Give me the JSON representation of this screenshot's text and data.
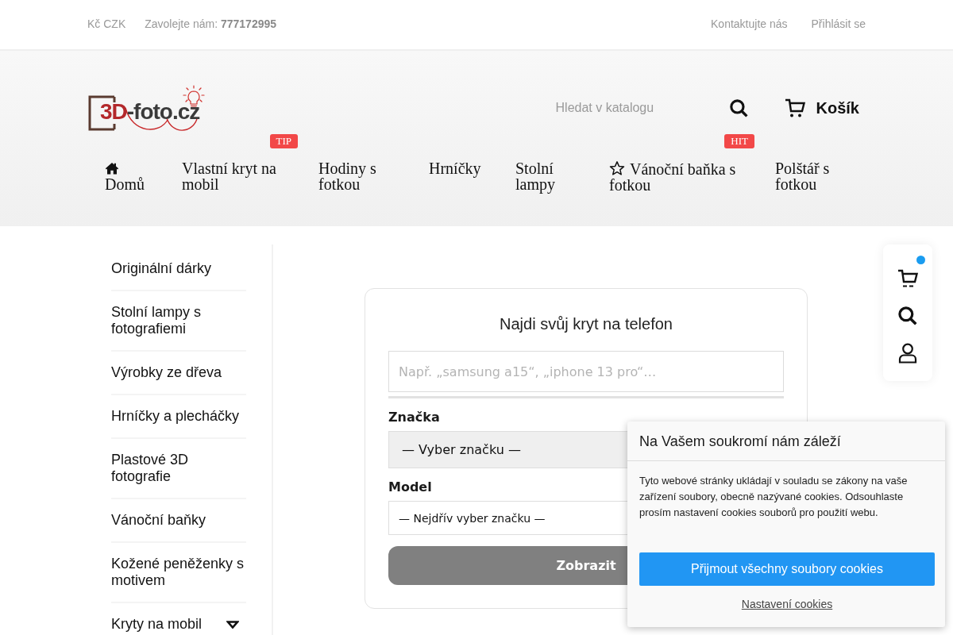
{
  "top_bar": {
    "currency": "Kč CZK",
    "phone_line": "Zavolejte nám: **777172995**",
    "links": [
      "Kontaktujte nás",
      "Přihlásit se"
    ]
  },
  "header": {
    "logo": {
      "accent": "3D",
      "text": "-foto.cz"
    },
    "search": {
      "placeholder": "Hledat v katalogu"
    },
    "cart": {
      "label": "Košík"
    }
  },
  "nav": [
    {
      "kind": "home",
      "label": "Domů"
    },
    {
      "kind": "link",
      "label": "Vlastní kryt na mobil",
      "badge": "TIP"
    },
    {
      "kind": "link",
      "label": "Hodiny s fotkou"
    },
    {
      "kind": "link",
      "label": "Hrníčky"
    },
    {
      "kind": "link",
      "label": "Stolní lampy"
    },
    {
      "kind": "featured",
      "label": "Vánoční baňka s fotkou",
      "badge": "HIT"
    },
    {
      "kind": "link",
      "label": "Polštář s fotkou"
    }
  ],
  "sidebar": {
    "items": [
      {
        "kind": "link",
        "label": "Originální dárky"
      },
      {
        "kind": "link",
        "label": "Stolní lampy s fotografiemi"
      },
      {
        "kind": "link",
        "label": "Výrobky ze dřeva"
      },
      {
        "kind": "link",
        "label": "Hrníčky a plecháčky"
      },
      {
        "kind": "link",
        "label": "Plastové 3D fotografie"
      },
      {
        "kind": "link",
        "label": "Vánoční baňky"
      },
      {
        "kind": "link",
        "label": "Kožené peněženky s motivem"
      },
      {
        "kind": "group",
        "label": "Kryty na mobil",
        "expanded": false
      }
    ]
  },
  "phone_finder": {
    "title": "Najdi svůj kryt na telefon",
    "search": {
      "placeholder": "Např. „samsung a15“, „iphone 13 pro“…"
    },
    "brand": {
      "label": "Značka",
      "value": "— Vyber značku —"
    },
    "model": {
      "label": "Model",
      "value": "— Nejdřív vyber značku —"
    },
    "button": "Zobrazit"
  },
  "cookie_banner": {
    "title": "Na Vašem soukromí nám záleží",
    "text": "Tyto webové stránky ukládají v souladu se zákony na vaše zařízení soubory, obecně nazývané cookies. Odsouhlaste prosím nastavení cookies souborů pro použití webu.",
    "accept_button": "Přijmout všechny soubory cookies",
    "settings_link": "Nastavení cookies"
  },
  "floating_toolbar": {
    "cart_has_items": true
  }
}
